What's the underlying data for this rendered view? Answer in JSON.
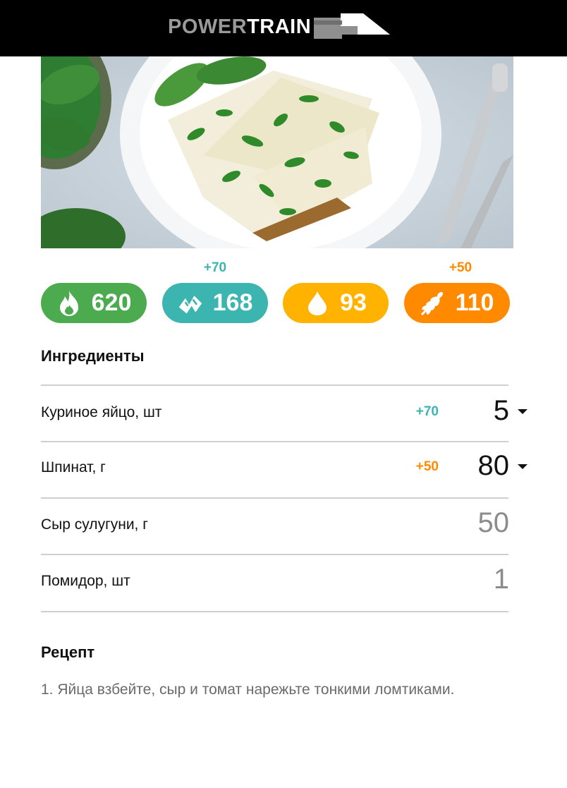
{
  "header": {
    "logo_part1": "POWER",
    "logo_part2": "TRAIN"
  },
  "hero": {
    "description": "spinach omelette slices on a white plate"
  },
  "macros": [
    {
      "icon": "flame-icon",
      "value": "620",
      "delta": "",
      "color": "#4caa4f"
    },
    {
      "icon": "meat-icon",
      "value": "168",
      "delta": "+70",
      "color": "#3cb4b0"
    },
    {
      "icon": "drop-icon",
      "value": "93",
      "delta": "",
      "color": "#ffb300"
    },
    {
      "icon": "wheat-icon",
      "value": "110",
      "delta": "+50",
      "color": "#ff8a00"
    }
  ],
  "ingredients_title": "Ингредиенты",
  "ingredients": [
    {
      "name": "Куриное яйцо, шт",
      "delta": "+70",
      "delta_color": "#3cb4b0",
      "qty": "5",
      "editable": true
    },
    {
      "name": "Шпинат, г",
      "delta": "+50",
      "delta_color": "#ff8a00",
      "qty": "80",
      "editable": true
    },
    {
      "name": "Сыр сулугуни, г",
      "delta": "",
      "qty": "50",
      "editable": false
    },
    {
      "name": "Помидор, шт",
      "delta": "",
      "qty": "1",
      "editable": false
    }
  ],
  "recipe_title": "Рецепт",
  "recipe_step": "1. Яйца взбейте, сыр и томат нарежьте тонкими ломтиками."
}
